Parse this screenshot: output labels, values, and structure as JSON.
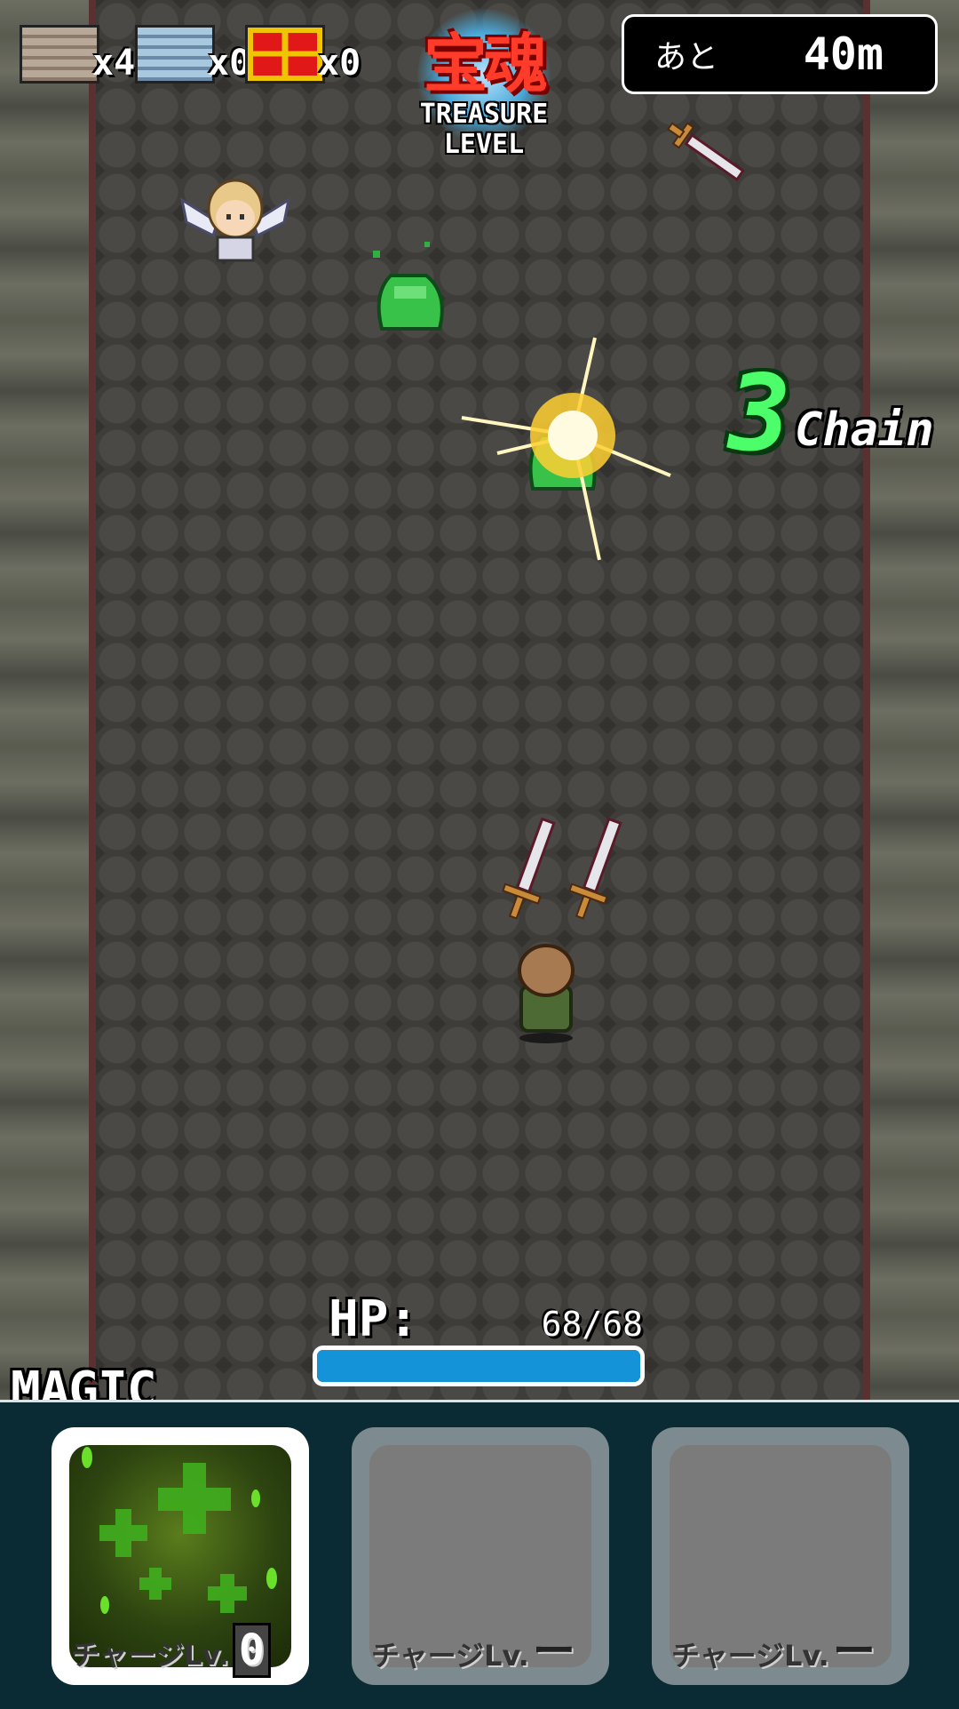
{
  "hud": {
    "items": [
      {
        "name": "wooden-chest",
        "count": "x4",
        "color": "#9b8a78"
      },
      {
        "name": "silver-chest",
        "count": "x0",
        "color": "#7aa5c8"
      },
      {
        "name": "gold-chest",
        "count": "x0",
        "color": "#d8b400"
      }
    ],
    "treasure": {
      "kanji": "宝魂",
      "line1": "TREASURE",
      "line2": "LEVEL"
    },
    "distance": {
      "label": "あと",
      "value": "40m"
    }
  },
  "combat": {
    "chain_number": "3",
    "chain_word": "Chain"
  },
  "player": {
    "hp_label": "HP:",
    "hp_value": "68/68",
    "hp_fraction": 1.0
  },
  "magic": {
    "label": "MAGIC",
    "slots": [
      {
        "caption": "チャージLv.",
        "level": "0",
        "state": "active",
        "icon": "heal-magic-icon"
      },
      {
        "caption": "チャージLv.",
        "level": "ー",
        "state": "empty"
      },
      {
        "caption": "チャージLv.",
        "level": "ー",
        "state": "empty"
      }
    ]
  },
  "colors": {
    "hp_bar": "#1493d8",
    "chain_green": "#4cff6a",
    "treasure_red": "#ff3b2a",
    "panel_bg": "#0a2b33"
  }
}
